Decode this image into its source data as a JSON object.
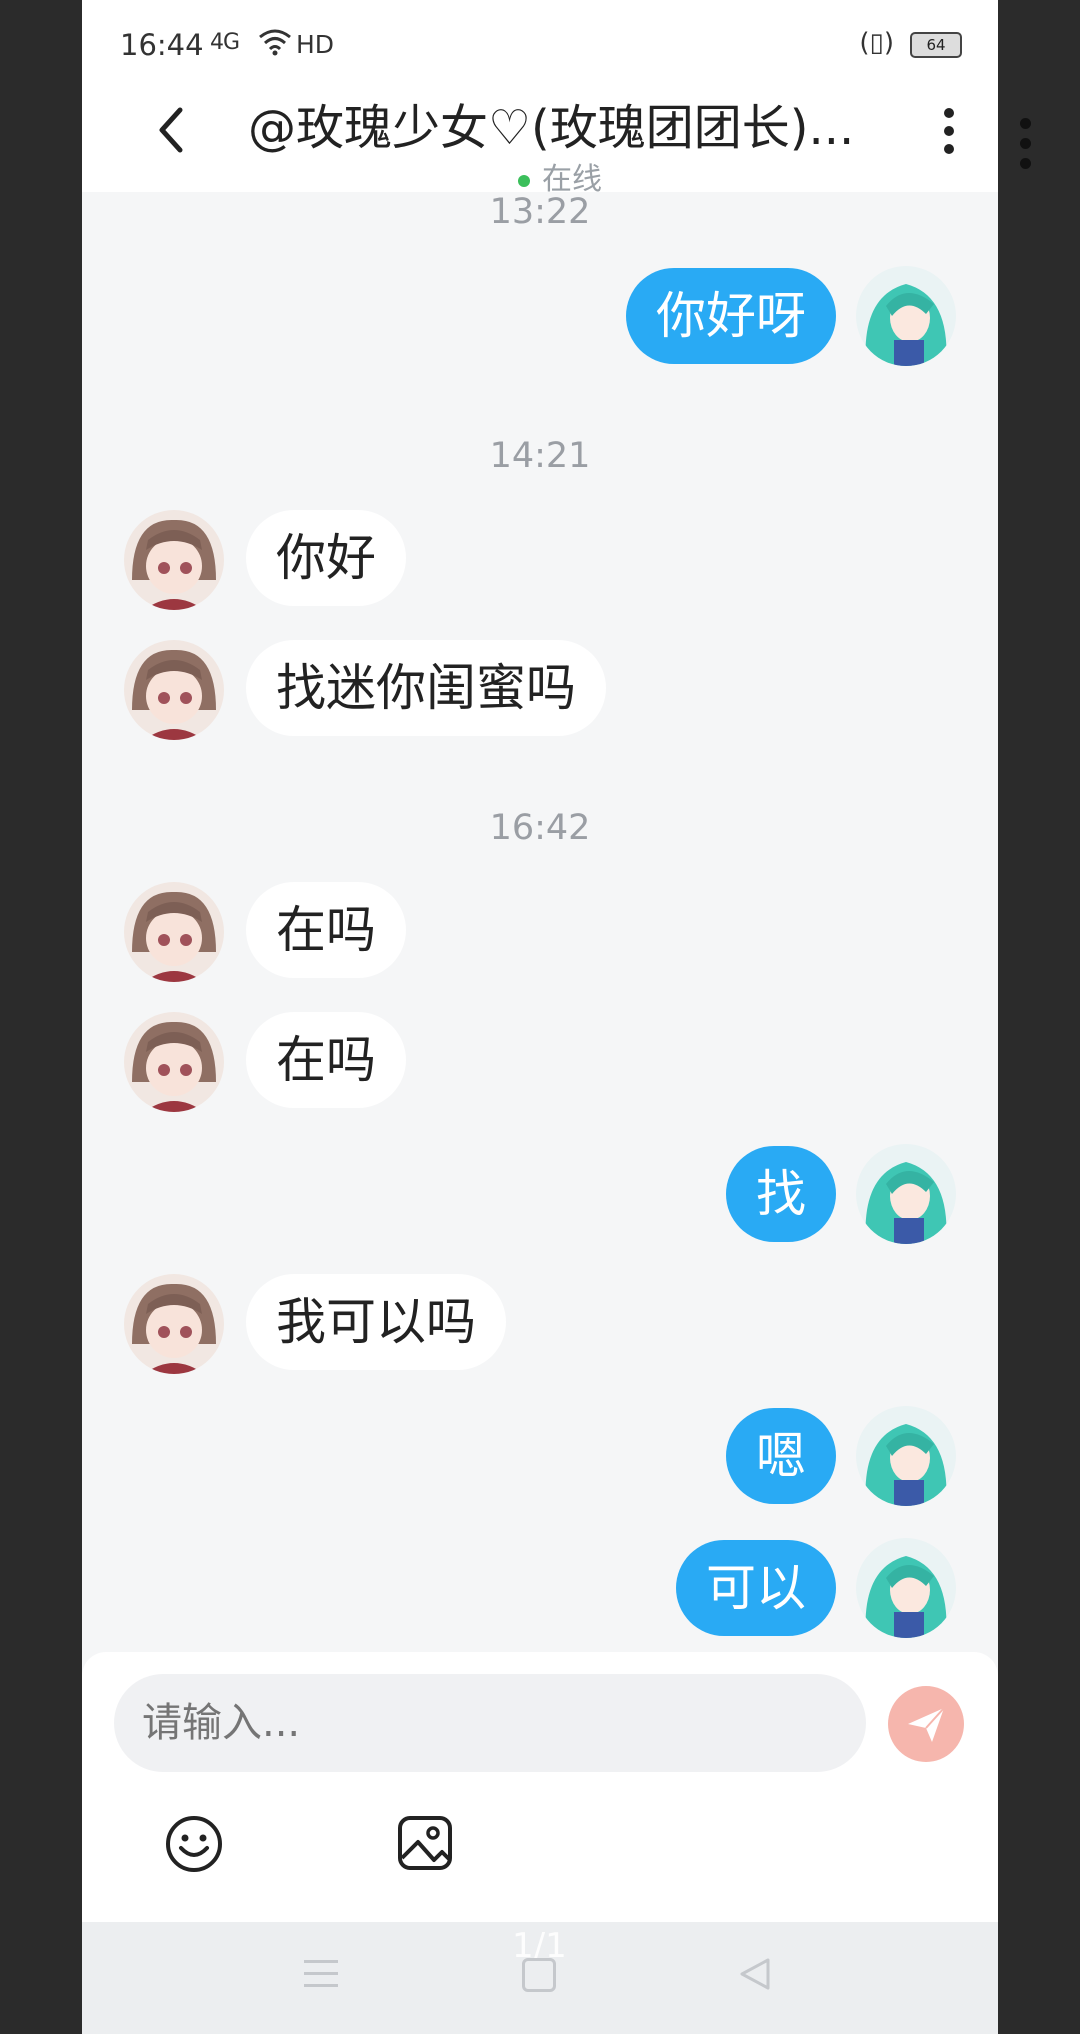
{
  "status_bar": {
    "time": "16:44",
    "signal": "4G",
    "network": "HD",
    "battery": "64"
  },
  "header": {
    "title": "@玫瑰少女♡(玫瑰团团长)...",
    "presence": "在线"
  },
  "messages": [
    {
      "type": "time",
      "text": "13:22"
    },
    {
      "type": "out",
      "text": "你好呀"
    },
    {
      "type": "time",
      "text": "14:21"
    },
    {
      "type": "in",
      "text": "你好"
    },
    {
      "type": "in",
      "text": "找迷你闺蜜吗"
    },
    {
      "type": "time",
      "text": "16:42"
    },
    {
      "type": "in",
      "text": "在吗"
    },
    {
      "type": "in",
      "text": "在吗"
    },
    {
      "type": "out",
      "text": "找"
    },
    {
      "type": "in",
      "text": "我可以吗"
    },
    {
      "type": "out",
      "text": "嗯"
    },
    {
      "type": "out",
      "text": "可以"
    }
  ],
  "composer": {
    "placeholder": "请输入..."
  },
  "nav": {
    "page_indicator": "1/1"
  },
  "icons": [
    "back-arrow-icon",
    "more-icon",
    "send-icon",
    "emoji-icon",
    "image-icon",
    "menu-icon",
    "home-icon",
    "back-icon"
  ],
  "colors": {
    "outgoing_bubble": "#29aaf4",
    "incoming_bubble": "#ffffff",
    "send_button": "#f6b6ad",
    "online_dot": "#3bbf5b"
  }
}
